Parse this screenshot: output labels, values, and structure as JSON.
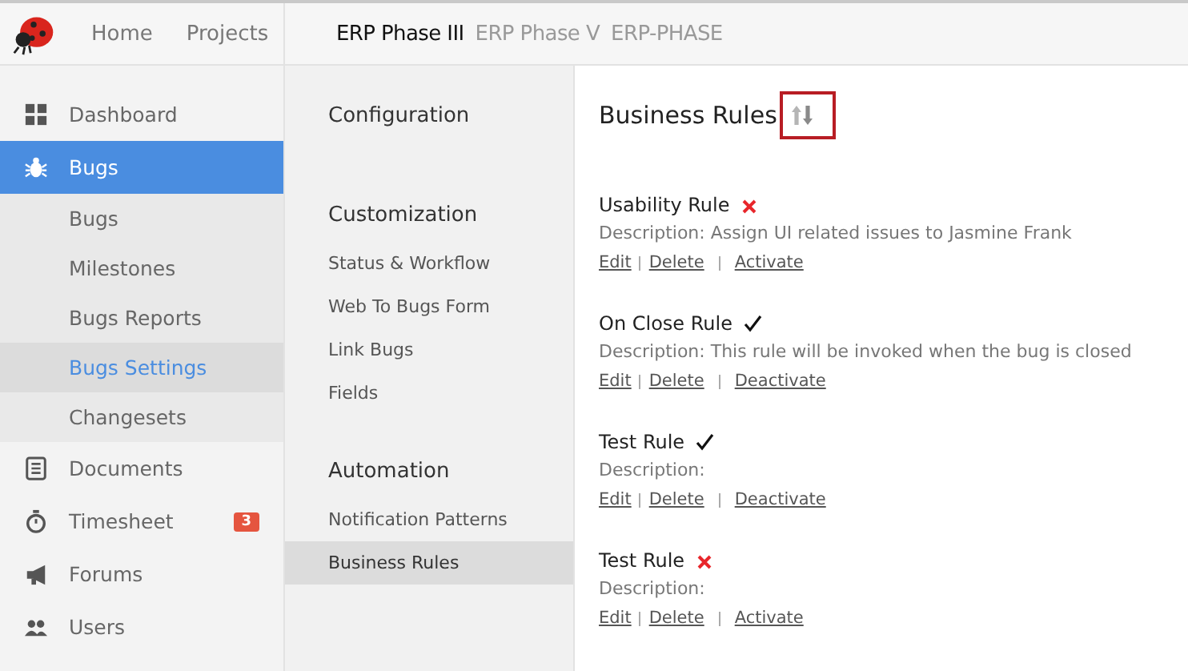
{
  "top_nav": [
    "Home",
    "Projects"
  ],
  "project_tabs": [
    {
      "label": "ERP Phase III",
      "selected": true
    },
    {
      "label": "ERP Phase V",
      "selected": false
    },
    {
      "label": "ERP-PHASE",
      "selected": false
    }
  ],
  "sidebar": {
    "items": [
      {
        "label": "Dashboard",
        "selected": false
      },
      {
        "label": "Bugs",
        "selected": true,
        "children": [
          {
            "label": "Bugs",
            "selected": false
          },
          {
            "label": "Milestones",
            "selected": false
          },
          {
            "label": "Bugs Reports",
            "selected": false
          },
          {
            "label": "Bugs Settings",
            "selected": true
          },
          {
            "label": "Changesets",
            "selected": false
          }
        ]
      },
      {
        "label": "Documents",
        "selected": false
      },
      {
        "label": "Timesheet",
        "selected": false,
        "badge": "3"
      },
      {
        "label": "Forums",
        "selected": false
      },
      {
        "label": "Users",
        "selected": false
      }
    ]
  },
  "settings_menu": [
    {
      "heading": "Configuration"
    },
    {
      "heading": "Customization",
      "items": [
        {
          "label": "Status & Workflow",
          "selected": false
        },
        {
          "label": "Web To Bugs Form",
          "selected": false
        },
        {
          "label": "Link Bugs",
          "selected": false
        },
        {
          "label": "Fields",
          "selected": false
        }
      ]
    },
    {
      "heading": "Automation",
      "items": [
        {
          "label": "Notification Patterns",
          "selected": false
        },
        {
          "label": "Business Rules",
          "selected": true
        }
      ]
    }
  ],
  "content": {
    "title": "Business Rules",
    "sort_highlighted": true,
    "rules": [
      {
        "name": "Usability Rule",
        "active": false,
        "description": "Description: Assign UI related issues to Jasmine Frank",
        "actions": [
          "Edit",
          "Delete",
          "Activate"
        ]
      },
      {
        "name": "On Close Rule",
        "active": true,
        "description": "Description: This rule will be invoked when the bug is closed",
        "actions": [
          "Edit",
          "Delete",
          "Deactivate"
        ]
      },
      {
        "name": "Test Rule",
        "active": true,
        "description": "Description:",
        "actions": [
          "Edit",
          "Delete",
          "Deactivate"
        ]
      },
      {
        "name": "Test Rule",
        "active": false,
        "description": "Description:",
        "actions": [
          "Edit",
          "Delete",
          "Activate"
        ]
      }
    ]
  }
}
